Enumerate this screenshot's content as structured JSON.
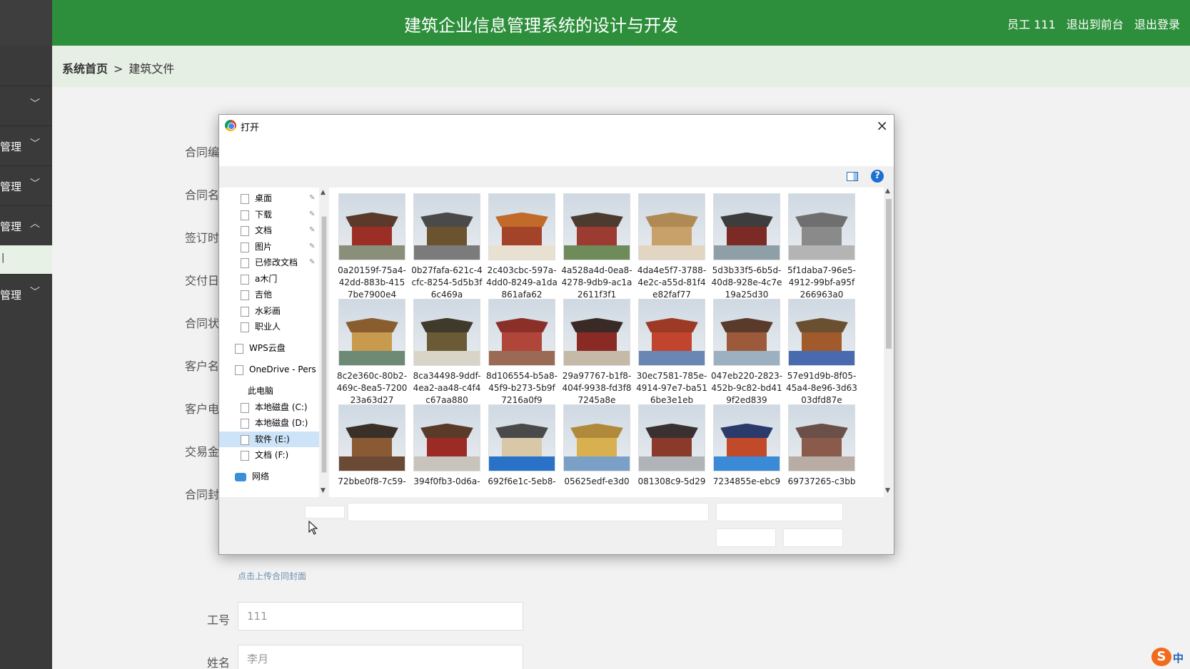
{
  "header": {
    "title": "建筑企业信息管理系统的设计与开发",
    "user": "员工 111",
    "to_front": "退出到前台",
    "logout": "退出登录"
  },
  "sidebar": {
    "items": [
      {
        "label": ""
      },
      {
        "label": "管理"
      },
      {
        "label": "管理"
      },
      {
        "label": "管理"
      },
      {
        "label": "管理"
      }
    ],
    "active_label": "|"
  },
  "breadcrumb": {
    "home": "系统首页",
    "sep": ">",
    "current": "建筑文件"
  },
  "form": {
    "labels": [
      "合同编",
      "合同名",
      "签订时",
      "交付日",
      "合同状",
      "客户名",
      "客户电",
      "交易金",
      "合同封"
    ],
    "upload_hint": "点击上传合同封面",
    "employee_id_label": "工号",
    "employee_id_value": "111",
    "name_label": "姓名",
    "name_placeholder": "李月"
  },
  "dialog": {
    "title": "打开",
    "close": "×",
    "help": "?",
    "nav": [
      {
        "label": "桌面",
        "pinned": true
      },
      {
        "label": "下载",
        "pinned": true
      },
      {
        "label": "文档",
        "pinned": true
      },
      {
        "label": "图片",
        "pinned": true
      },
      {
        "label": "已修改文档",
        "pinned": true
      },
      {
        "label": "a木门"
      },
      {
        "label": "吉他"
      },
      {
        "label": "水彩画"
      },
      {
        "label": "职业人"
      },
      {
        "label": "WPS云盘"
      },
      {
        "label": "OneDrive - Pers"
      },
      {
        "label": "此电脑"
      },
      {
        "label": "本地磁盘 (C:)"
      },
      {
        "label": "本地磁盘 (D:)"
      },
      {
        "label": "软件 (E:)"
      },
      {
        "label": "文档 (F:)"
      },
      {
        "label": "网络"
      }
    ],
    "files": [
      "0a20159f-75a4-42dd-883b-4157be7900e4",
      "0b27fafa-621c-4cfc-8254-5d5b3f6c469a",
      "2c403cbc-597a-4dd0-8249-a1da861afa62",
      "4a528a4d-0ea8-4278-9db9-ac1a2611f3f1",
      "4da4e5f7-3788-4e2c-a55d-81f4e82faf77",
      "5d3b33f5-6b5d-40d8-928e-4c7e19a25d30",
      "5f1daba7-96e5-4912-99bf-a95f266963a0",
      "8c2e360c-80b2-469c-8ea5-720023a63d27",
      "8ca34498-9ddf-4ea2-aa48-c4f4c67aa880",
      "8d106554-b5a8-45f9-b273-5b9f7216a0f9",
      "29a97767-b1f8-404f-9938-fd3f87245a8e",
      "30ec7581-785e-4914-97e7-ba516be3e1eb",
      "047eb220-2823-452b-9c82-bd419f2ed839",
      "57e91d9b-8f05-45a4-8e96-3d6303dfd87e",
      "72bbe0f8-7c59-",
      "394f0fb3-0d6a-",
      "692f6e1c-5eb8-",
      "05625edf-e3d0",
      "081308c9-5d29",
      "7234855e-ebc9",
      "69737265-c3bb"
    ],
    "thumb_colors": [
      [
        "#5b3a2b",
        "#9c2f25",
        "#8a8f7c"
      ],
      [
        "#4a4a4a",
        "#6b5330",
        "#7b7b7b"
      ],
      [
        "#c26a2a",
        "#a3442a",
        "#e8e0d0"
      ],
      [
        "#4e3b30",
        "#9b3b32",
        "#6f8b5a"
      ],
      [
        "#b08a55",
        "#c8a06a",
        "#e2d6c2"
      ],
      [
        "#3d3d3d",
        "#7b2a25",
        "#8f9fa8"
      ],
      [
        "#6f6f6f",
        "#8a8a8a",
        "#b4b4b4"
      ],
      [
        "#8a5d2e",
        "#c79a4e",
        "#6d8a74"
      ],
      [
        "#3f3a2a",
        "#6a5a35",
        "#d8d4c8"
      ],
      [
        "#8a3028",
        "#b0463a",
        "#9a6a55"
      ],
      [
        "#3a2a25",
        "#8a2a25",
        "#c5b9a8"
      ],
      [
        "#9c3a25",
        "#c0442e",
        "#6a86b5"
      ],
      [
        "#5a3b2b",
        "#9c5a3a",
        "#9bb0c0"
      ],
      [
        "#6a5030",
        "#a05a2b",
        "#4a6ab0"
      ],
      [
        "#3a3028",
        "#8a5a35",
        "#6a4a35"
      ],
      [
        "#5a3a28",
        "#9c2a25",
        "#c8c4bc"
      ],
      [
        "#4a4a4a",
        "#d8c8a8",
        "#2a72c8"
      ],
      [
        "#b08a3a",
        "#d8b050",
        "#7aa0c8"
      ],
      [
        "#3a3030",
        "#8a3a2a",
        "#b0b4b8"
      ],
      [
        "#2a3a6a",
        "#c04a2a",
        "#3a8ad8"
      ],
      [
        "#6a5048",
        "#8a5a4a",
        "#b8aca4"
      ]
    ]
  }
}
